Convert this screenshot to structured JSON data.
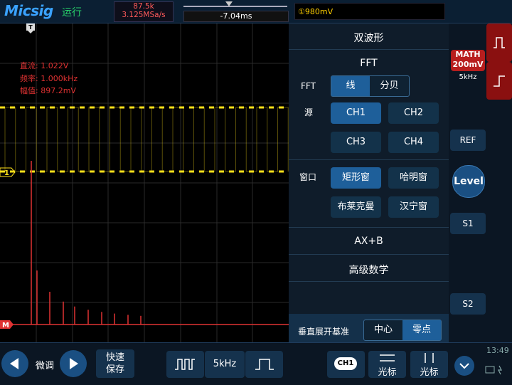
{
  "topbar": {
    "brand": "Micsig",
    "run_state": "运行",
    "memory_depth": "87.5k",
    "sample_rate": "3.125MSa/s",
    "trigger_position": "-7.04ms",
    "trigger_level": "①980mV"
  },
  "markers": {
    "trigger": "T",
    "channel1": "1",
    "math": "M"
  },
  "measurements": {
    "dc": "直流: 1.022V",
    "freq": "频率: 1.000kHz",
    "amp": "幅值: 897.2mV"
  },
  "menu": {
    "title": "双波形",
    "fft_header": "FFT",
    "fft_label": "FFT",
    "fft_mode_options": [
      "线",
      "分贝"
    ],
    "fft_mode_selected": "线",
    "source_label": "源",
    "sources": [
      "CH1",
      "CH2",
      "CH3",
      "CH4"
    ],
    "source_selected": "CH1",
    "window_label": "窗口",
    "windows": [
      "矩形窗",
      "哈明窗",
      "布莱克曼",
      "汉宁窗"
    ],
    "window_selected": "矩形窗",
    "axb": "AX+B",
    "advanced": "高级数学",
    "vbase_label": "垂直展开基准",
    "vbase_options": [
      "中心",
      "零点"
    ],
    "vbase_selected": "零点"
  },
  "right": {
    "math_label": "MATH",
    "math_scale": "200mV",
    "math_freq": "5kHz",
    "ref": "REF",
    "level": "Level",
    "s1": "S1",
    "s2": "S2"
  },
  "bottom": {
    "fine_label": "微调",
    "quick_save": [
      "快速",
      "保存"
    ],
    "freq": "5kHz",
    "ch_badge": "CH1",
    "cursor1": "光标",
    "cursor2": "光标",
    "time": "13:49"
  },
  "colors": {
    "ch1": "#ffe01a",
    "fft": "#e03232",
    "accent": "#1e5f9a"
  },
  "chart_data": {
    "type": "bar",
    "description": "FFT spectrum trace (MATH, red) over CH1 square wave (yellow)",
    "harmonic_values": [
      1.0,
      0.33,
      0.2,
      0.14,
      0.11,
      0.09,
      0.077,
      0.067,
      0.059,
      0.053
    ]
  }
}
